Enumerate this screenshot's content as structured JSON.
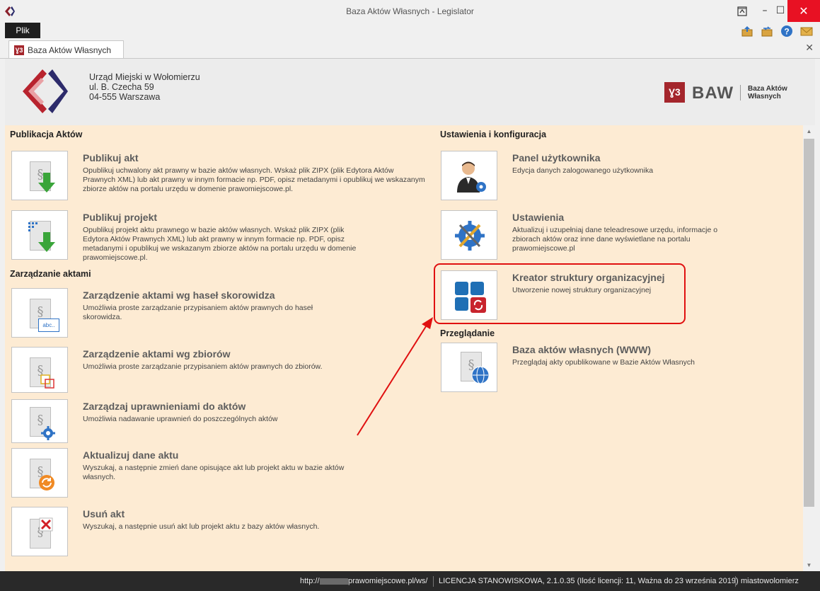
{
  "window": {
    "title": "Baza Aktów Własnych - Legislator"
  },
  "menu": {
    "file": "Plik"
  },
  "tab": {
    "icon_text": "Ɣ3",
    "label": "Baza Aktów Własnych"
  },
  "header": {
    "address": [
      "Urząd Miejski w Wołomierzu",
      "ul. B. Czecha 59",
      "04-555 Warszawa"
    ],
    "logo": {
      "mark": "Ɣ3",
      "name": "BAW",
      "sub1": "Baza Aktów",
      "sub2": "Własnych"
    }
  },
  "sections": {
    "publish": "Publikacja Aktów",
    "manage": "Zarządzanie aktami",
    "settings": "Ustawienia i konfiguracja",
    "browse": "Przeglądanie"
  },
  "items": {
    "publish_act": {
      "title": "Publikuj akt",
      "desc": "Opublikuj uchwalony akt prawny w bazie aktów własnych.  Wskaż plik ZIPX (plik Edytora Aktów Prawnych XML) lub akt prawny w innym formacie np. PDF, opisz metadanymi i opublikuj we wskazanym zbiorze aktów na portalu urzędu w domenie prawomiejscowe.pl."
    },
    "publish_project": {
      "title": "Publikuj projekt",
      "desc": "Opublikuj projekt aktu prawnego w bazie aktów własnych.  Wskaż plik ZIPX (plik Edytora Aktów Prawnych XML) lub akt prawny w innym formacie np. PDF, opisz metadanymi i opublikuj we wskazanym zbiorze aktów na portalu urzędu w domenie prawomiejscowe.pl."
    },
    "manage_index": {
      "title": "Zarządzenie aktami wg haseł skorowidza",
      "desc": "Umożliwia proste zarządzanie przypisaniem aktów prawnych do haseł skorowidza.",
      "icon_text": "abc.."
    },
    "manage_sets": {
      "title": "Zarządzenie aktami wg zbiorów",
      "desc": "Umożliwia proste zarządzanie przypisaniem aktów prawnych do zbiorów."
    },
    "manage_perms": {
      "title": "Zarządzaj uprawnieniami do aktów",
      "desc": "Umożliwia nadawanie uprawnień do poszczególnych aktów"
    },
    "update_act": {
      "title": "Aktualizuj dane aktu",
      "desc": "Wyszukaj, a następnie zmień dane opisujące akt lub projekt aktu w bazie aktów własnych."
    },
    "delete_act": {
      "title": "Usuń akt",
      "desc": "Wyszukaj, a następnie usuń akt lub projekt aktu z bazy aktów własnych."
    },
    "user_panel": {
      "title": "Panel użytkownika",
      "desc": "Edycja danych zalogowanego użytkownika"
    },
    "settings": {
      "title": "Ustawienia",
      "desc": "Aktualizuj i uzupełniaj dane teleadresowe urzędu, informacje o zbiorach aktów oraz inne dane wyświetlane na portalu prawomiejscowe.pl"
    },
    "org_wizard": {
      "title": "Kreator struktury organizacyjnej",
      "desc": "Utworzenie nowej struktury organizacyjnej"
    },
    "browse_www": {
      "title": "Baza aktów własnych (WWW)",
      "desc": "Przeglądaj akty opublikowane w Bazie Aktów Własnych"
    }
  },
  "status": {
    "url_prefix": "http://",
    "url_rest": "prawomiejscowe.pl/ws/",
    "license": "LICENCJA STANOWISKOWA, 2.1.0.35 (Ilość licencji: 11, Ważna do 23 września 2019)",
    "user": "miastowolomierz"
  },
  "colors": {
    "brand": "#a4262c",
    "content_bg": "#fdebd3",
    "highlight": "#e01010",
    "status_bg": "#292929",
    "green_arrow": "#3aa53a",
    "tile_blue": "#1f6fb5"
  }
}
